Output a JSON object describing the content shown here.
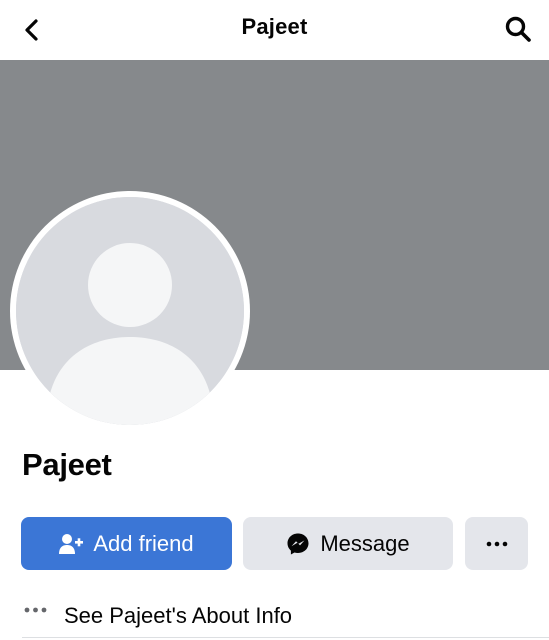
{
  "header": {
    "title": "Pajeet",
    "back_icon": "chevron-left-icon",
    "search_icon": "search-icon"
  },
  "profile": {
    "name": "Pajeet",
    "cover_color": "#86898c",
    "photo": "profile-photo-placeholder"
  },
  "actions": {
    "add_friend_label": "Add friend",
    "message_label": "Message",
    "more_label": "···",
    "add_friend_color": "#3b76d6",
    "secondary_color": "#e4e6eb"
  },
  "about": {
    "label": "See Pajeet's About Info",
    "icon": "ellipsis-icon"
  }
}
